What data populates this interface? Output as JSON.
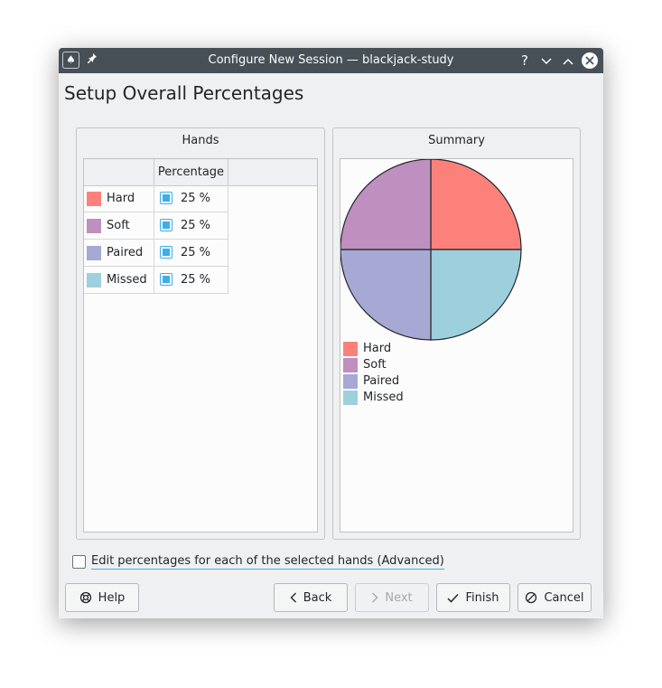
{
  "window": {
    "title": "Configure New Session — blackjack-study"
  },
  "titlebar": {
    "help_glyph": "?",
    "minimize_glyph": "⌄",
    "maximize_glyph": "⌃"
  },
  "page": {
    "title": "Setup Overall Percentages"
  },
  "hands_group": {
    "title": "Hands",
    "columns": [
      "",
      "Percentage"
    ],
    "rows": [
      {
        "label": "Hard",
        "color": "#fd817b",
        "percentage": "25 %"
      },
      {
        "label": "Soft",
        "color": "#bf8fbf",
        "percentage": "25 %"
      },
      {
        "label": "Paired",
        "color": "#a8a8d4",
        "percentage": "25 %"
      },
      {
        "label": "Missed",
        "color": "#9ecfdd",
        "percentage": "25 %"
      }
    ]
  },
  "summary_group": {
    "title": "Summary"
  },
  "chart_data": {
    "type": "pie",
    "labels": [
      "Hard",
      "Missed",
      "Paired",
      "Soft"
    ],
    "values": [
      25,
      25,
      25,
      25
    ],
    "colors": [
      "#fd817b",
      "#9ecfdd",
      "#a8a8d4",
      "#bf8fbf"
    ],
    "legend": [
      "Hard",
      "Soft",
      "Paired",
      "Missed"
    ],
    "legend_colors": [
      "#fd817b",
      "#bf8fbf",
      "#a8a8d4",
      "#9ecfdd"
    ],
    "legend_position": "bottom-left"
  },
  "advanced": {
    "label": "Edit percentages for each of the selected hands (Advanced)",
    "checked": false
  },
  "buttons": {
    "help": "Help",
    "back": "Back",
    "next": "Next",
    "finish": "Finish",
    "cancel": "Cancel"
  }
}
